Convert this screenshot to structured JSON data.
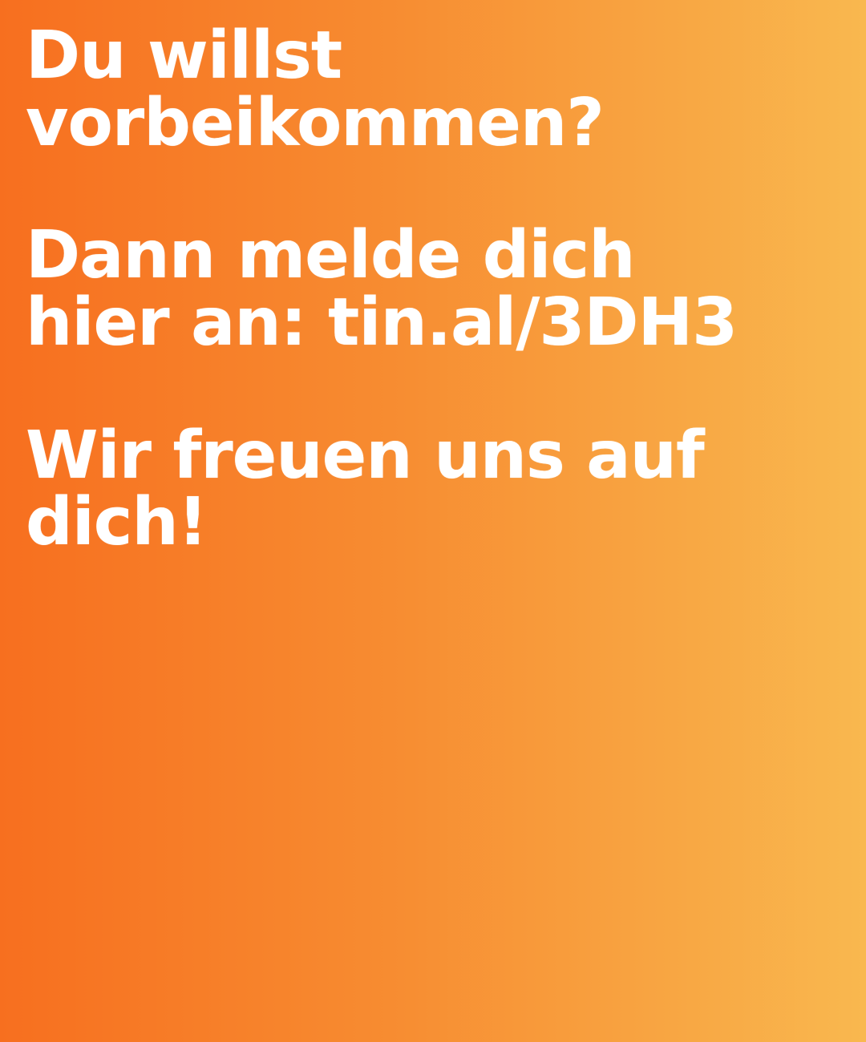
{
  "background": {
    "colors": {
      "left": "#f76f1f",
      "middle": "#f78c31",
      "right": "#f9b84f"
    }
  },
  "message": {
    "question": [
      "Du willst",
      "vorbeikommen?"
    ],
    "signup": [
      "Dann melde dich",
      "hier an: tin.al/3DH3"
    ],
    "closing": [
      "Wir freuen uns auf",
      "dich!"
    ]
  }
}
